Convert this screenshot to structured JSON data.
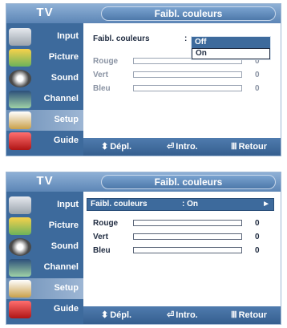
{
  "colors": {
    "panel": "#3d6a9c",
    "active": "#9db6d4",
    "text_dark": "#1f2b40"
  },
  "screens": [
    {
      "tv_title": "TV",
      "menu_title": "Faibl. couleurs",
      "sidebar": [
        {
          "label": "Input",
          "icon": "input-icon"
        },
        {
          "label": "Picture",
          "icon": "picture-icon"
        },
        {
          "label": "Sound",
          "icon": "sound-icon"
        },
        {
          "label": "Channel",
          "icon": "channel-icon"
        },
        {
          "label": "Setup",
          "icon": "setup-icon"
        },
        {
          "label": "Guide",
          "icon": "guide-icon"
        }
      ],
      "setting": {
        "label": "Faibl. couleurs",
        "colon": ":"
      },
      "dropdown": [
        "Off",
        "On"
      ],
      "dropdown_selected": "On",
      "sliders": [
        {
          "label": "Rouge",
          "value": "0",
          "level": 0.0
        },
        {
          "label": "Vert",
          "value": "0",
          "level": 0.0
        },
        {
          "label": "Bleu",
          "value": "0",
          "level": 0.0
        }
      ],
      "hints": {
        "move": "Dépl.",
        "enter": "Intro.",
        "back": "Retour"
      }
    },
    {
      "tv_title": "TV",
      "menu_title": "Faibl. couleurs",
      "sidebar": [
        {
          "label": "Input",
          "icon": "input-icon"
        },
        {
          "label": "Picture",
          "icon": "picture-icon"
        },
        {
          "label": "Sound",
          "icon": "sound-icon"
        },
        {
          "label": "Channel",
          "icon": "channel-icon"
        },
        {
          "label": "Setup",
          "icon": "setup-icon"
        },
        {
          "label": "Guide",
          "icon": "guide-icon"
        }
      ],
      "setting": {
        "label": "Faibl. couleurs",
        "value": ": On",
        "arrow": "►"
      },
      "sliders": [
        {
          "label": "Rouge",
          "value": "0",
          "level": 0.0
        },
        {
          "label": "Vert",
          "value": "0",
          "level": 0.0
        },
        {
          "label": "Bleu",
          "value": "0",
          "level": 0.0
        }
      ],
      "hints": {
        "move": "Dépl.",
        "enter": "Intro.",
        "back": "Retour"
      }
    }
  ]
}
